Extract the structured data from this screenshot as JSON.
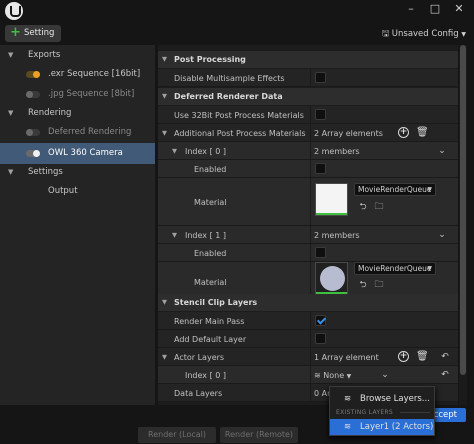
{
  "titlebar": {
    "logo_icon": "unreal-logo-icon",
    "minimize": "–",
    "maximize": "□",
    "close": "✕"
  },
  "toolbar": {
    "setting_label": "Setting",
    "config_label": "Unsaved Config",
    "config_icon": "save-icon"
  },
  "sidebar": {
    "items": [
      {
        "label": "Exports"
      },
      {
        "label": ".exr Sequence [16bit]"
      },
      {
        "label": ".jpg Sequence [8bit]"
      },
      {
        "label": "Rendering"
      },
      {
        "label": "Deferred Rendering"
      },
      {
        "label": "OWL 360 Camera"
      },
      {
        "label": "Settings"
      },
      {
        "label": "Output"
      }
    ]
  },
  "details": {
    "post_processing": {
      "title": "Post Processing",
      "disable_msaa": "Disable Multisample Effects"
    },
    "deferred": {
      "title": "Deferred Renderer Data",
      "use_32bit": "Use 32Bit Post Process Materials",
      "additional": "Additional Post Process Materials",
      "additional_value": "2 Array elements",
      "index0": "Index [ 0 ]",
      "index0_value": "2 members",
      "enabled": "Enabled",
      "material": "Material",
      "material_value": "MovieRenderQueue",
      "index1": "Index [ 1 ]",
      "index1_value": "2 members",
      "enabled2": "Enabled",
      "material2": "Material",
      "material2_value": "MovieRenderQueue"
    },
    "stencil": {
      "title": "Stencil Clip Layers",
      "render_main": "Render Main Pass",
      "add_default": "Add Default Layer",
      "actor_layers": "Actor Layers",
      "actor_layers_value": "1 Array element",
      "index0": "Index [ 0 ]",
      "index0_value": "None",
      "data_layers": "Data Layers",
      "data_layers_value": "0 Ar"
    }
  },
  "popup": {
    "browse": "Browse Layers...",
    "existing_header": "EXISTING LAYERS",
    "layer1": "Layer1 (2 Actors)"
  },
  "bottom": {
    "render_local": "Render (Local)",
    "render_remote": "Render (Remote)",
    "accept": "Accept"
  }
}
